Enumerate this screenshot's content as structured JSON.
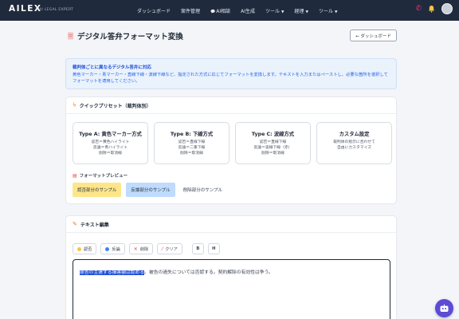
{
  "nav": {
    "logo": "AILEX",
    "logo_sub": "AI LEGAL EXPERT",
    "items": [
      {
        "label": "ダッシュボード"
      },
      {
        "label": "案件管理"
      },
      {
        "label": "AI相談"
      },
      {
        "label": "AI生成"
      },
      {
        "label": "ツール"
      },
      {
        "label": "経理"
      },
      {
        "label": "ツール"
      }
    ]
  },
  "header": {
    "title": "デジタル答弁フォーマット変換",
    "back_button": "← ダッシュボード"
  },
  "info": {
    "title": "裁判体ごとに異なるデジタル答弁に対応",
    "text": "黄色マーカー・青マーカー・直線下線・波線下線など、指定された方式に応じてフォーマットを変換します。テキストを入力またはペーストし、必要な箇所を選択してフォーマットを適用してください。"
  },
  "presets": {
    "heading": "クイックプリセット（裁判体別）",
    "items": [
      {
        "title": "Type A: 黄色マーカー方式",
        "lines": [
          "認否＝黄色ハイライト",
          "反論＝青ハイライト",
          "削除＝取消線"
        ]
      },
      {
        "title": "Type B: 下線方式",
        "lines": [
          "認否＝直線下線",
          "反論＝二重下線",
          "削除＝取消線"
        ]
      },
      {
        "title": "Type C: 波線方式",
        "lines": [
          "認否＝直線下線",
          "反論＝波線下線（赤）",
          "削除＝取消線"
        ]
      },
      {
        "title": "カスタム設定",
        "lines": [
          "裁判体の指示に合わせて",
          "自由にカスタマイズ"
        ]
      }
    ],
    "preview_label": "フォーマットプレビュー",
    "samples": [
      "認否部分のサンプル",
      "反論部分のサンプル",
      "削除部分のサンプル"
    ]
  },
  "editor": {
    "heading": "テキスト編集",
    "buttons": {
      "admit": "認否",
      "rebut": "反論",
      "delete": "削除",
      "clear": "クリア",
      "bold": "B",
      "heading": "H"
    },
    "selected_text": "原告の主張する損害額は認める",
    "rest_text": "。被告の過失については否認する。契約解除の有効性は争う。"
  },
  "colors": {
    "nav_bg": "#1f2a3d",
    "accent": "#f97316",
    "admit": "#fde68a",
    "rebut": "#bfdbfe",
    "fab": "#5b4bd6"
  }
}
